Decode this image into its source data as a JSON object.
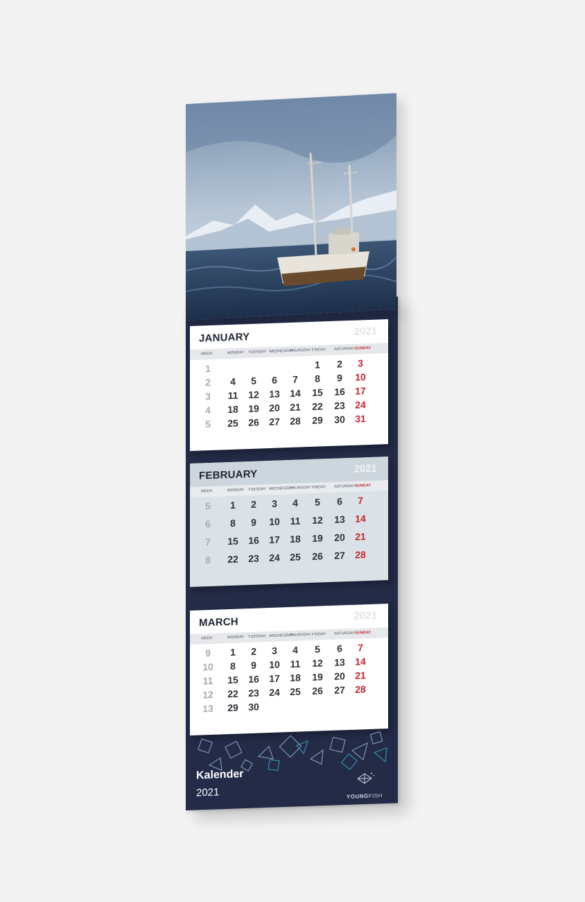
{
  "calendar": {
    "year": "2021",
    "weekdays": [
      "WEEK",
      "MONDAY",
      "TUESDAY",
      "WEDNESDAY",
      "THURSDAY",
      "FRIDAY",
      "SATURDAY",
      "SUNDAY"
    ],
    "months": [
      {
        "name": "JANUARY",
        "weeks": [
          {
            "week": "1",
            "days": [
              "",
              "",
              "",
              "",
              "1",
              "2",
              "3"
            ]
          },
          {
            "week": "2",
            "days": [
              "4",
              "5",
              "6",
              "7",
              "8",
              "9",
              "10"
            ]
          },
          {
            "week": "3",
            "days": [
              "11",
              "12",
              "13",
              "14",
              "15",
              "16",
              "17"
            ]
          },
          {
            "week": "4",
            "days": [
              "18",
              "19",
              "20",
              "21",
              "22",
              "23",
              "24"
            ]
          },
          {
            "week": "5",
            "days": [
              "25",
              "26",
              "27",
              "28",
              "29",
              "30",
              "31"
            ]
          }
        ]
      },
      {
        "name": "FEBRUARY",
        "weeks": [
          {
            "week": "5",
            "days": [
              "1",
              "2",
              "3",
              "4",
              "5",
              "6",
              "7"
            ]
          },
          {
            "week": "6",
            "days": [
              "8",
              "9",
              "10",
              "11",
              "12",
              "13",
              "14"
            ]
          },
          {
            "week": "7",
            "days": [
              "15",
              "16",
              "17",
              "18",
              "19",
              "20",
              "21"
            ]
          },
          {
            "week": "8",
            "days": [
              "22",
              "23",
              "24",
              "25",
              "26",
              "27",
              "28"
            ]
          }
        ]
      },
      {
        "name": "MARCH",
        "weeks": [
          {
            "week": "9",
            "days": [
              "1",
              "2",
              "3",
              "4",
              "5",
              "6",
              "7"
            ]
          },
          {
            "week": "10",
            "days": [
              "8",
              "9",
              "10",
              "11",
              "12",
              "13",
              "14"
            ]
          },
          {
            "week": "11",
            "days": [
              "15",
              "16",
              "17",
              "18",
              "19",
              "20",
              "21"
            ]
          },
          {
            "week": "12",
            "days": [
              "22",
              "23",
              "24",
              "25",
              "26",
              "27",
              "28"
            ]
          },
          {
            "week": "13",
            "days": [
              "29",
              "30",
              "",
              "",
              "",
              "",
              ""
            ]
          }
        ]
      }
    ]
  },
  "footer": {
    "title": "Kalender",
    "year": "2021",
    "brand_bold": "YOUNG",
    "brand_light": "FISH"
  },
  "colors": {
    "board": "#232b47",
    "sunday": "#c4232b"
  }
}
